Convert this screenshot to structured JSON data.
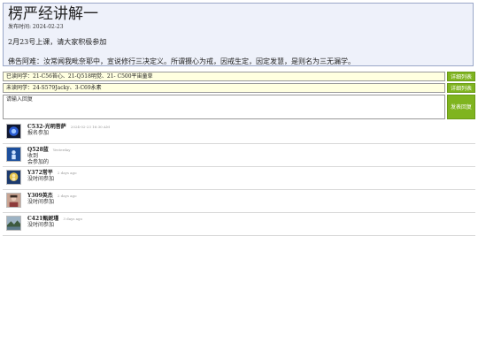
{
  "announcement": {
    "title": "楞严经讲解一",
    "date": "发布时间: 2024-02-23",
    "line1": "2月23号上课，请大家积极参加",
    "line2": "佛告阿难：汝常闻我毗奈耶中，宣说修行三决定义。所谓摄心为戒，因戒生定，因定发慧，是则名为三无漏学。"
  },
  "read_row": {
    "text": "已读同学：21-C56苔心、21-Q518明觉、21- C500平宙童草",
    "button": "详细列表"
  },
  "unread_row": {
    "text": "未读同学：24-S579Jacky、3-C69永素",
    "button": "详细列表"
  },
  "comment": {
    "placeholder": "请输入回复",
    "button": "发表回复"
  },
  "comments": [
    {
      "user": "C532-光明菩萨",
      "time": "2024-02-23 16:30 AM",
      "lines": [
        "报名参加"
      ],
      "avatar": "blue-orb-avatar"
    },
    {
      "user": "Q528蓝",
      "time": "Yesterday",
      "lines": [
        "收到",
        "会参加的"
      ],
      "avatar": "blue-figure-avatar"
    },
    {
      "user": "Y372常平",
      "time": "2 days ago",
      "lines": [
        "没时间参加"
      ],
      "avatar": "buddha-avatar"
    },
    {
      "user": "Y309英杰",
      "time": "2 days ago",
      "lines": [
        "没时间参加"
      ],
      "avatar": "portrait-avatar"
    },
    {
      "user": "C421甄妮瑾",
      "time": "3 days ago",
      "lines": [
        "没时间参加"
      ],
      "avatar": "landscape-avatar"
    }
  ],
  "colors": {
    "accent_button": "#7fb41f",
    "field_bg": "#ffffe0",
    "announce_bg": "#eef1fa"
  }
}
